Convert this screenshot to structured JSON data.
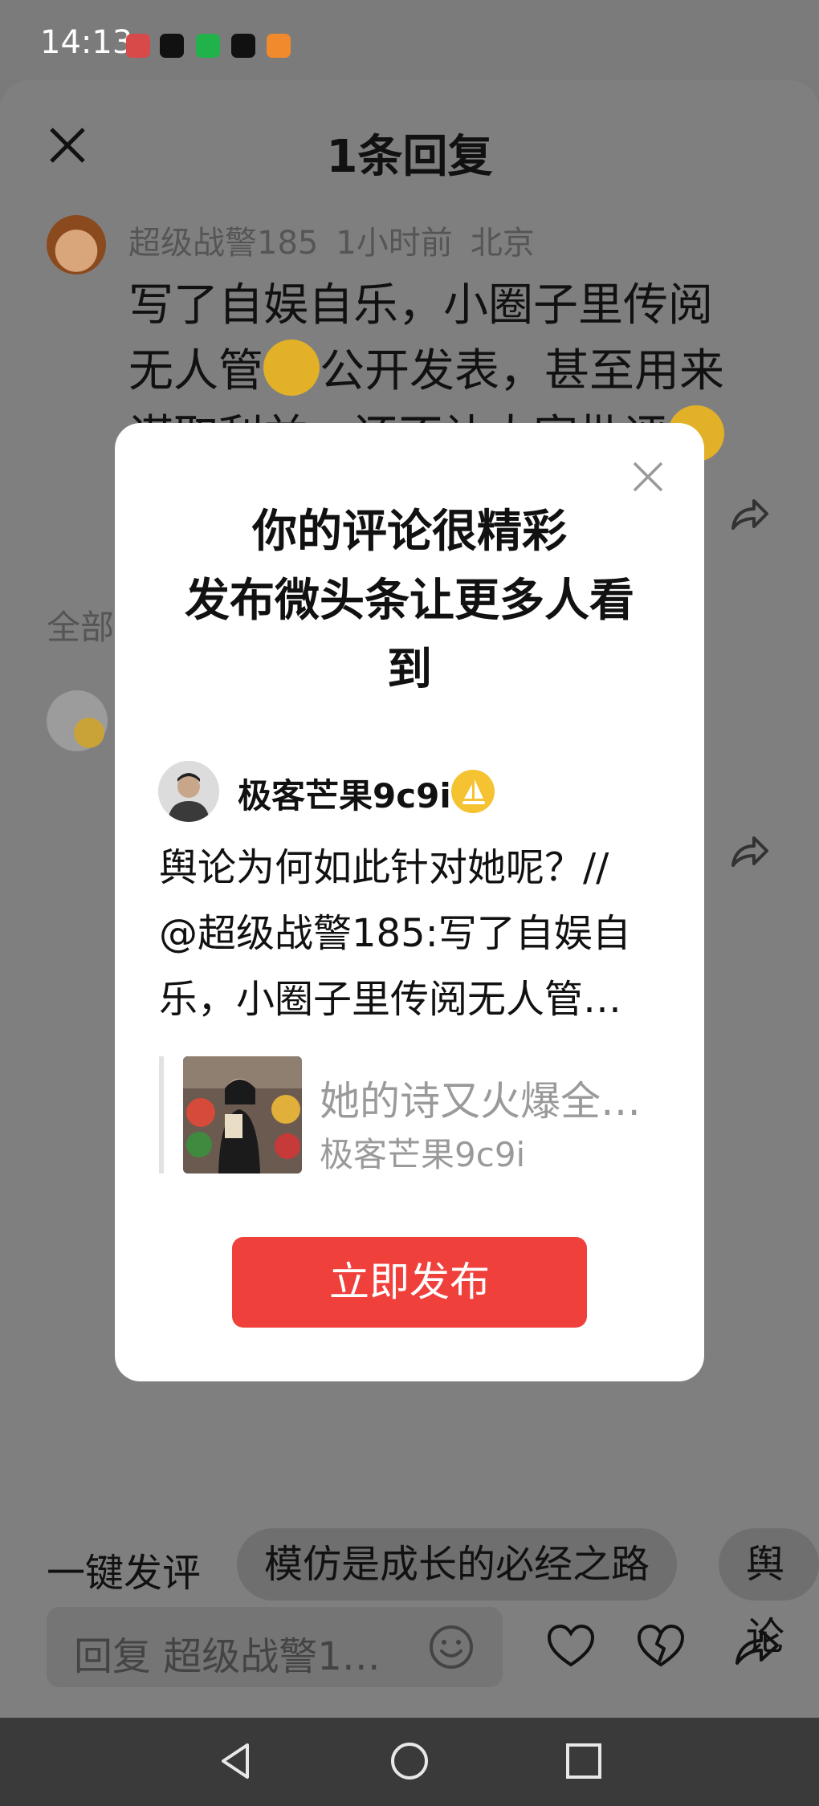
{
  "status_bar": {
    "time": "14:13"
  },
  "sheet": {
    "title": "1条回复",
    "comment": {
      "author": "超级战警185",
      "time_ago": "1小时前",
      "location": "北京",
      "line1": "写了自娱自乐，小圈子里传阅",
      "line2_a": "无人管",
      "line2_b": "公开发表，甚至用来",
      "line3": "谋取利益，还不让大家批评"
    },
    "all_replies_label": "全部"
  },
  "modal": {
    "title_line1": "你的评论很精彩",
    "title_line2": "发布微头条让更多人看",
    "title_line3": "到",
    "username": "极客芒果9c9i",
    "body_line1": "舆论为何如此针对她呢？//",
    "body_line2": "@超级战警185:写了自娱自",
    "body_line3": "乐，小圈子里传阅无人管…",
    "quoted_title": "她的诗又火爆全…",
    "quoted_author": "极客芒果9c9i",
    "publish_label": "立即发布"
  },
  "bottom": {
    "quick_comment_label": "一键发评",
    "chips": [
      "模仿是成长的必经之路",
      "舆论"
    ],
    "reply_placeholder": "回复 超级战警1…"
  },
  "colors": {
    "accent_red": "#f0403c",
    "badge_gold": "#f5c331",
    "dim_overlay": "#7f7f7f"
  }
}
